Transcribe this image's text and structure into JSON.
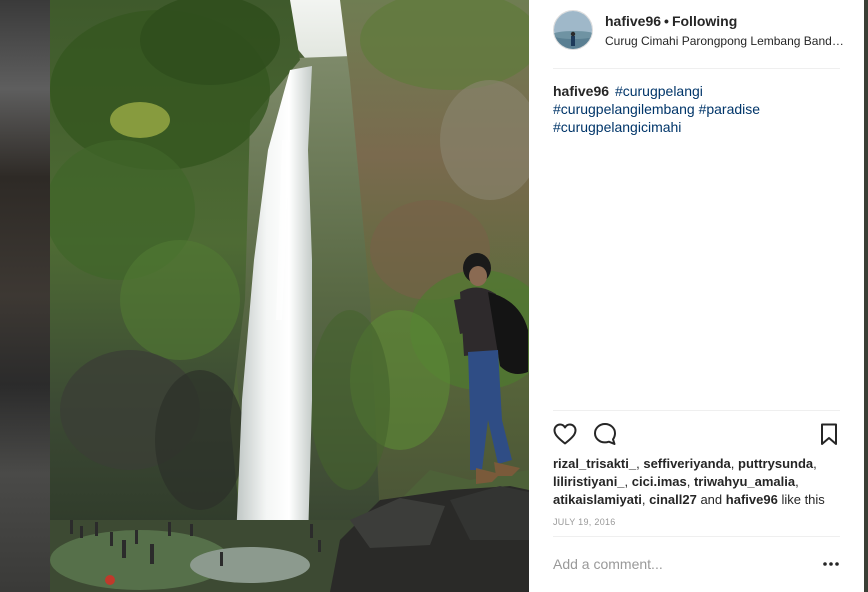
{
  "post": {
    "username": "hafive96",
    "separator": "•",
    "follow_status": "Following",
    "location": "Curug Cimahi Parongpong Lembang Bandung",
    "caption_author": "hafive96",
    "hashtags": [
      "#curugpelangi",
      "#curugpelangilembang",
      "#paradise",
      "#curugpelangicimahi"
    ],
    "likes": {
      "users_line1": [
        "rizal_trisakti_",
        "seffiveriyanda",
        "puttrysunda"
      ],
      "users_line2": [
        "liliristiyani_",
        "cici.imas",
        "triwahyu_amalia"
      ],
      "users_line3": [
        "atikaislamiyati",
        "cinall27"
      ],
      "and_word": "and",
      "last_user": "hafive96",
      "suffix": "like this"
    },
    "date": "JULY 19, 2016",
    "comment_placeholder": "Add a comment...",
    "more_label": "•••"
  },
  "icons": {
    "like": "heart-icon",
    "comment": "speech-bubble-icon",
    "save": "bookmark-icon",
    "more": "more-options-icon"
  },
  "colors": {
    "hashtag": "#003569",
    "text": "#262626",
    "muted": "#999999",
    "divider": "#efefef"
  }
}
